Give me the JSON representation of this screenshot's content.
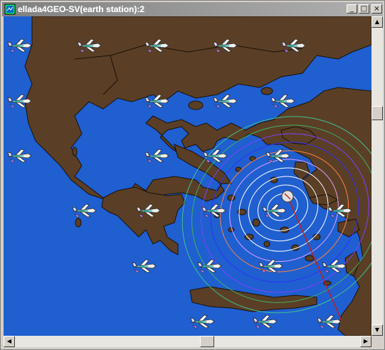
{
  "window": {
    "title": "ellada4GEO-SV(earth station):2",
    "minimize_glyph": "_",
    "maximize_glyph": "□",
    "close_glyph": "×"
  },
  "icons": {
    "app": "map-app-icon",
    "aircraft": "aircraft-icon",
    "earth_station": "earth-station-icon"
  },
  "colors": {
    "sea": "#1f5fd0",
    "land": "#5a3f26",
    "coast": "#1a1008"
  },
  "contours": {
    "colors": [
      "#ffffff",
      "#ffffff",
      "#ffffff",
      "#ffffff",
      "#e0a0ff",
      "#ff8040",
      "#3030ff",
      "#8040ff",
      "#40b060",
      "#40c090"
    ]
  },
  "scrollbars": {
    "up": "▲",
    "down": "▼",
    "left": "◀",
    "right": "▶"
  }
}
